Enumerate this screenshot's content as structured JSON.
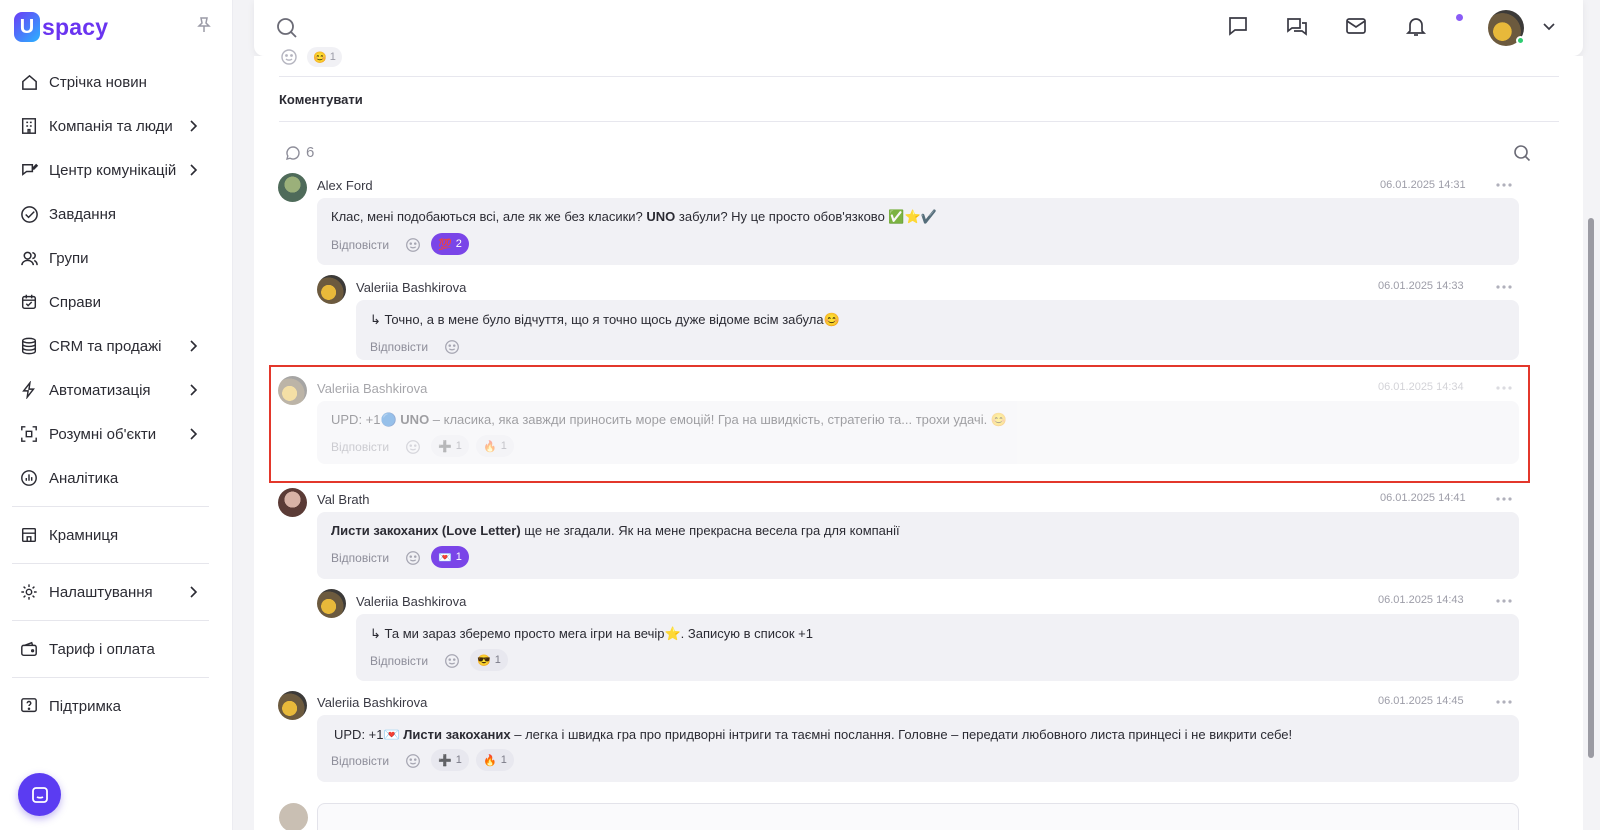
{
  "app": {
    "logo_text": "spacy",
    "logo_mark": "U",
    "accent": "#6a34f0"
  },
  "sidebar": {
    "items": [
      {
        "label": "Стрічка новин",
        "icon": "home-icon",
        "has_children": false
      },
      {
        "label": "Компанія та люди",
        "icon": "building-icon",
        "has_children": true
      },
      {
        "label": "Центр комунікацій",
        "icon": "edit-chat-icon",
        "has_children": true
      },
      {
        "label": "Завдання",
        "icon": "check-circle-icon",
        "has_children": false
      },
      {
        "label": "Групи",
        "icon": "users-icon",
        "has_children": false
      },
      {
        "label": "Справи",
        "icon": "calendar-icon",
        "has_children": false
      },
      {
        "label": "CRM та продажі",
        "icon": "database-icon",
        "has_children": true
      },
      {
        "label": "Автоматизація",
        "icon": "lightning-icon",
        "has_children": true
      },
      {
        "label": "Розумні об'єкти",
        "icon": "scan-icon",
        "has_children": true
      },
      {
        "label": "Аналітика",
        "icon": "chart-icon",
        "has_children": false
      },
      {
        "label": "Крамниця",
        "icon": "store-icon",
        "has_children": false
      },
      {
        "label": "Налаштування",
        "icon": "gear-icon",
        "has_children": true
      },
      {
        "label": "Тариф і оплата",
        "icon": "wallet-icon",
        "has_children": false
      },
      {
        "label": "Підтримка",
        "icon": "help-icon",
        "has_children": false
      }
    ]
  },
  "post": {
    "top_reaction_count": "1",
    "comment_label": "Коментувати",
    "comment_count": "6"
  },
  "comments": [
    {
      "author": "Alex Ford",
      "time": "06.01.2025 14:31",
      "text_parts": [
        "Клас, мені подобаються всі, але як же без класики? ",
        "UNO",
        " забули? Ну це просто обов'язково ✅⭐✔️"
      ],
      "reply_label": "Відповісти",
      "reactions": [
        {
          "emoji": "💯",
          "count": "2",
          "active": true
        }
      ]
    },
    {
      "author": "Valeriia Bashkirova",
      "time": "06.01.2025 14:33",
      "text": "↳ Точно, а в мене було відчуття, що я точно щось дуже відоме всім забула😊",
      "reply_label": "Відповісти",
      "reactions": []
    },
    {
      "author": "Valeriia Bashkirova",
      "time": "06.01.2025 14:34",
      "text_parts": [
        "UPD: +1🔵 ",
        "UNO",
        "  – класика, яка завжди приносить море емоцій! Гра на швидкість, стратегію та... трохи удачі. 😊"
      ],
      "reply_label": "Відповісти",
      "reactions": [
        {
          "emoji": "➕",
          "count": "1",
          "active": false
        },
        {
          "emoji": "🔥",
          "count": "1",
          "active": false
        }
      ]
    },
    {
      "author": "Val Brath",
      "time": "06.01.2025 14:41",
      "text_parts": [
        "Листи закоханих (Love Letter)",
        " ще не згадали. Як на мене прекрасна весела гра для компанії"
      ],
      "reply_label": "Відповісти",
      "reactions": [
        {
          "emoji": "💌",
          "count": "1",
          "active": true
        }
      ]
    },
    {
      "author": "Valeriia Bashkirova",
      "time": "06.01.2025 14:43",
      "text": "↳ Та ми зараз зберемо просто мега ігри на вечір⭐. Записую в список +1",
      "reply_label": "Відповісти",
      "reactions": [
        {
          "emoji": "😎",
          "count": "1",
          "active": false
        }
      ]
    },
    {
      "author": "Valeriia Bashkirova",
      "time": "06.01.2025 14:45",
      "text_parts": [
        "UPD: +1💌 ",
        "Листи закоханих",
        " – легка і швидка гра про придворні інтриги та таємні послання. Головне – передати любовного листа принцесі і не викрити себе!"
      ],
      "reply_label": "Відповісти",
      "reactions": [
        {
          "emoji": "➕",
          "count": "1",
          "active": false
        },
        {
          "emoji": "🔥",
          "count": "1",
          "active": false
        }
      ]
    }
  ]
}
